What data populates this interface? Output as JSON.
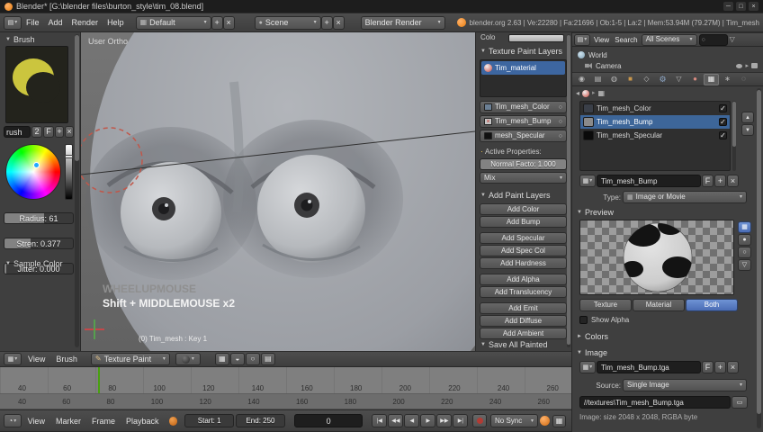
{
  "icons": {
    "collapse": "▼",
    "expand": "►",
    "caret": "▾",
    "close": "×",
    "plus": "+",
    "check": "✓",
    "minimize": "─",
    "maximize": "□",
    "left": "◂",
    "right": "▸",
    "up": "▲",
    "down": "▼",
    "jump_start": "|◀",
    "rew": "◀◀",
    "play_rev": "◀",
    "play": "▶",
    "ff": "▶▶",
    "jump_end": "▶|",
    "search": "○",
    "funnel": "▽",
    "grid": "▦",
    "pencil": "✎",
    "back": "◂",
    "arrow_sep": "▸",
    "sphere": "●",
    "editor_menu": "▤",
    "clock": "◔",
    "magnet": "◒",
    "circle": "○",
    "ring": "○",
    "folder": "▭",
    "dot": "·"
  },
  "titlebar": {
    "title": "Blender* [G:\\blender files\\burton_style\\tim_08.blend]"
  },
  "infobar": {
    "menus": [
      "File",
      "Add",
      "Render",
      "Help"
    ],
    "layout_value": "Default",
    "scene_value": "Scene",
    "engine_value": "Blender Render",
    "stats": "blender.org 2.63 | Ve:22280 | Fa:21696 | Ob:1-5 | La:2 | Mem:53.94M (79.27M) | Tim_mesh"
  },
  "toolshelf": {
    "panel_title": "Brush",
    "brush_name": "rush",
    "users_count": "2",
    "fake_user": "F",
    "radius_label": "Radius: 61",
    "strength_label": "Stren: 0.377",
    "jitter_label": "Jitter: 0.000",
    "sample_title": "Sample Color"
  },
  "viewport": {
    "view_name": "User Ortho",
    "key_line1": "WHEELUPMOUSE",
    "key_line2": "Shift + MIDDLEMOUSE x2",
    "status_text": "(0) Tim_mesh : Key 1"
  },
  "paint_layers": {
    "color_label": "Colo",
    "panel_title": "Texture Paint Layers",
    "material_name": "Tim_material",
    "layers": [
      "Tim_mesh_Color",
      "Tim_mesh_Bump",
      "mesh_Specular"
    ],
    "active_label": "Active Properties:",
    "normal_factor_label": "Normal Facto: 1.000",
    "blend_value": "Mix",
    "add_title": "Add Paint Layers",
    "add_buttons": [
      "Add Color",
      "Add Bump",
      "Add Specular",
      "Add Spec Col",
      "Add Hardness",
      "Add Alpha",
      "Add Translucency",
      "Add Emit",
      "Add Diffuse",
      "Add Ambient"
    ],
    "save_title": "Save All Painted"
  },
  "outliner": {
    "view_menu": "View",
    "search_menu": "Search",
    "scope_value": "All Scenes",
    "items": [
      "World",
      "Camera"
    ]
  },
  "properties": {
    "tab_icons": [
      "◉",
      "▤",
      "◍",
      "■",
      "◇",
      "⚙",
      "▽",
      "●",
      "▦",
      "∗",
      "◌"
    ],
    "texture_slots": [
      "Tim_mesh_Color",
      "Tim_mesh_Bump",
      "Tim_mesh_Specular"
    ],
    "name_value": "Tim_mesh_Bump",
    "fake_user": "F",
    "type_label": "Type:",
    "type_value": "Image or Movie",
    "preview_title": "Preview",
    "preview_tabs": [
      "Texture",
      "Material",
      "Both"
    ],
    "show_alpha_label": "Show Alpha",
    "colors_title": "Colors",
    "image_title": "Image",
    "image_name": "Tim_mesh_Bump.tga",
    "source_label": "Source:",
    "source_value": "Single Image",
    "filepath": "//textures\\Tim_mesh_Bump.tga",
    "image_info": "Image: size 2048 x 2048, RGBA byte"
  },
  "viewport_header": {
    "menus": [
      "View",
      "Brush"
    ],
    "mode_value": "Texture Paint"
  },
  "timeline": {
    "ticks": [
      "40",
      "60",
      "80",
      "100",
      "120",
      "140",
      "160",
      "180",
      "200",
      "220",
      "240",
      "260"
    ],
    "menus": [
      "View",
      "Marker",
      "Frame",
      "Playback"
    ],
    "start_value": "Start: 1",
    "end_value": "End: 250",
    "frame_value": "0",
    "sync_value": "No Sync"
  },
  "colors": {
    "accent_blue": "#4a6cb4",
    "frame_line_green": "#49a010",
    "brush_cursor_red": "#c0574a",
    "logo_orange": "#e87d0d"
  }
}
